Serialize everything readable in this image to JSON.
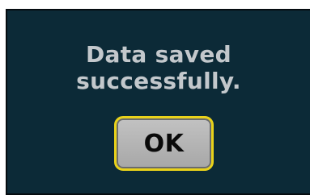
{
  "dialog": {
    "message_line1": "Data saved",
    "message_line2": "successfully.",
    "ok_label": "OK"
  },
  "colors": {
    "dialog_background": "#0c2a37",
    "message_text": "#c3c8cc",
    "button_border": "#e9d21a",
    "button_face": "#b5b5b5"
  }
}
